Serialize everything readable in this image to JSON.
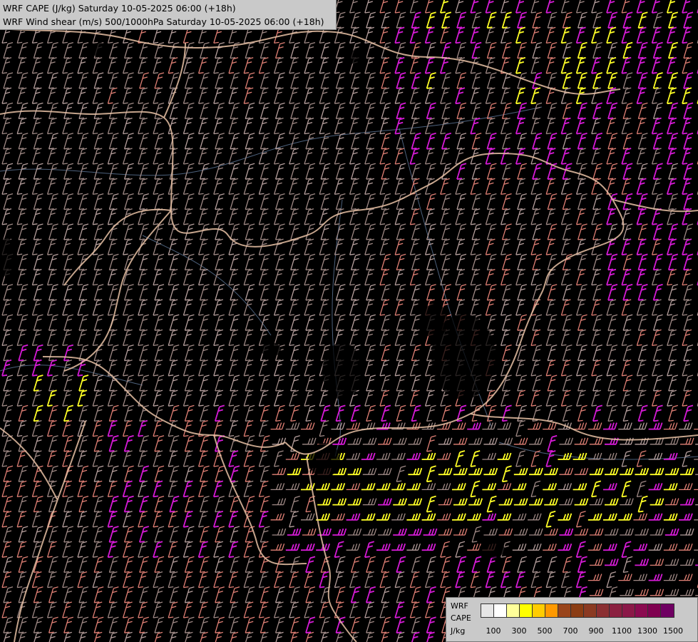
{
  "title": {
    "line1": "WRF CAPE (J/kg) Saturday 10-05-2025 06:00 (+18h)",
    "line2": "WRF Wind shear (m/s) 500/1000hPa Saturday 10-05-2025 06:00 (+18h)"
  },
  "legend": {
    "model": "WRF",
    "field": "CAPE",
    "unit": "J/kg",
    "colors": [
      "#e6e6e6",
      "#ffffff",
      "#ffff99",
      "#ffff00",
      "#ffcc00",
      "#ff9900",
      "#99441a",
      "#8b3d14",
      "#8b3a22",
      "#8b2f32",
      "#8b2040",
      "#8b1848",
      "#8b0a50",
      "#800050",
      "#6f0062"
    ],
    "tick_labels": [
      "100",
      "300",
      "500",
      "700",
      "900",
      "1100",
      "1300",
      "1500"
    ]
  },
  "colors": {
    "background": "#000000",
    "barb_default": "#a08a86",
    "barb_light": "#b7a09e",
    "barb_salmon": "#e28176",
    "barb_magenta": "#d61bd6",
    "barb_yellow": "#ffff26",
    "border": "#e7c1a5",
    "river": "#6d8ab0"
  }
}
